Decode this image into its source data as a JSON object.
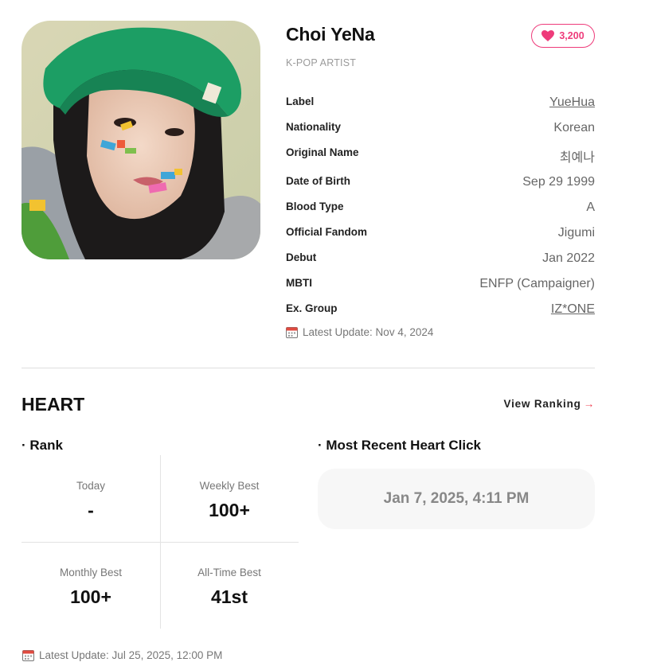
{
  "profile": {
    "name": "Choi YeNa",
    "role": "K-POP ARTIST",
    "hearts": "3,200",
    "photo_alt": "Choi YeNa photo"
  },
  "details": [
    {
      "key": "Label",
      "value": "YueHua",
      "link": true
    },
    {
      "key": "Nationality",
      "value": "Korean",
      "link": false
    },
    {
      "key": "Original Name",
      "value": "최예나",
      "link": false
    },
    {
      "key": "Date of Birth",
      "value": "Sep 29 1999",
      "link": false
    },
    {
      "key": "Blood Type",
      "value": "A",
      "link": false
    },
    {
      "key": "Official Fandom",
      "value": "Jigumi",
      "link": false
    },
    {
      "key": "Debut",
      "value": "Jan 2022",
      "link": false
    },
    {
      "key": "MBTI",
      "value": "ENFP (Campaigner)",
      "link": false
    },
    {
      "key": "Ex. Group",
      "value": "IZ*ONE",
      "link": true
    }
  ],
  "profile_update": "Latest Update: Nov 4, 2024",
  "heart_section": {
    "title": "HEART",
    "view_ranking": "View Ranking",
    "rank_title": "· Rank",
    "recent_title": "· Most Recent Heart Click",
    "recent_value": "Jan 7, 2025, 4:11 PM",
    "ranks": {
      "today_label": "Today",
      "today_value": "-",
      "weekly_label": "Weekly Best",
      "weekly_value": "100+",
      "monthly_label": "Monthly Best",
      "monthly_value": "100+",
      "alltime_label": "All-Time Best",
      "alltime_value": "41st"
    },
    "update": "Latest Update: Jul 25, 2025, 12:00 PM"
  },
  "colors": {
    "accent_pink": "#ee3b7a",
    "arrow_red": "#ef3b4d"
  }
}
